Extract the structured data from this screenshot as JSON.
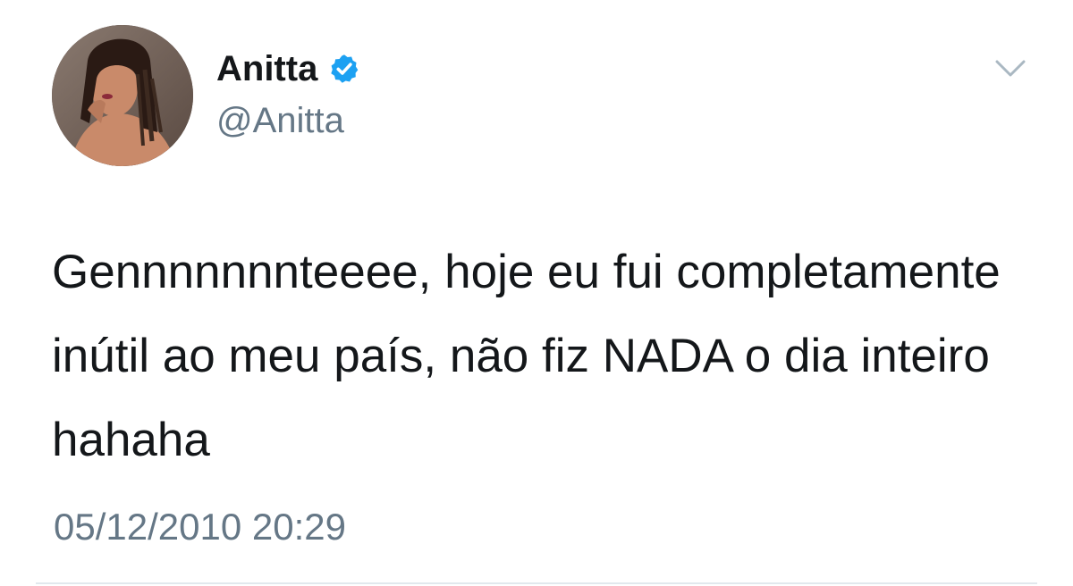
{
  "tweet": {
    "author": {
      "display_name": "Anitta",
      "handle": "@Anitta",
      "verified": true
    },
    "text": "Gennnnnnnteeee, hoje eu fui completamente inútil ao meu país, não fiz NADA o dia inteiro hahaha",
    "timestamp": "05/12/2010 20:29"
  },
  "icons": {
    "verified": "verified-badge-icon",
    "menu": "chevron-down-icon"
  },
  "colors": {
    "verified_blue": "#1da1f2",
    "text_primary": "#14171a",
    "text_secondary": "#657786",
    "divider": "#e1e8ed"
  }
}
